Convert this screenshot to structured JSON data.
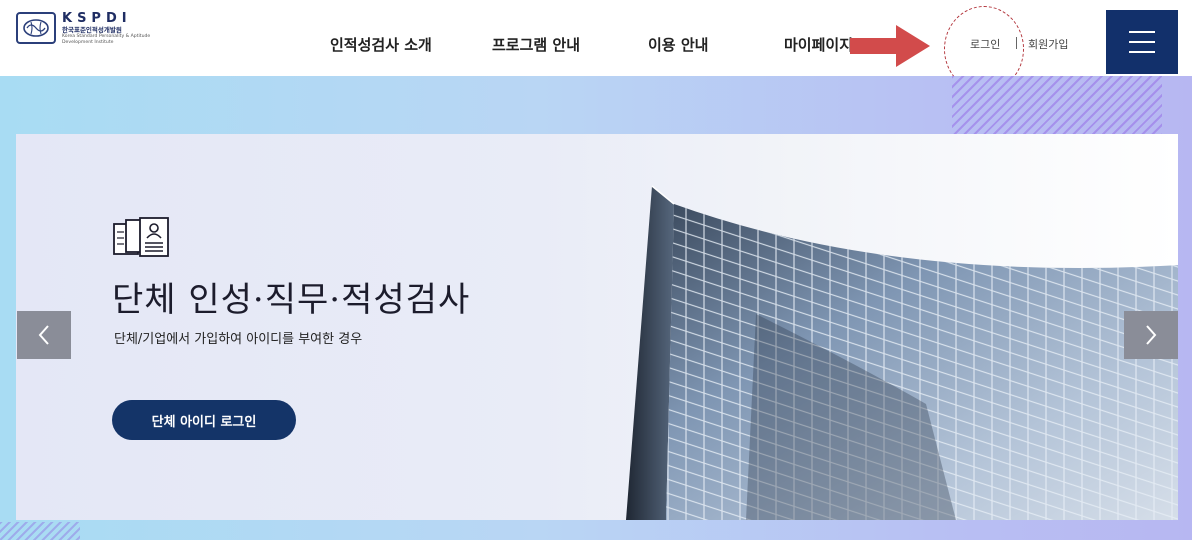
{
  "header": {
    "logo": {
      "abbr": "KSPDI",
      "name_ko": "한국표준인적성개발원",
      "name_en": "Korea Standard Personality & Aptitude Development Institute"
    },
    "nav": [
      {
        "label": "인적성검사 소개"
      },
      {
        "label": "프로그램 안내"
      },
      {
        "label": "이용 안내"
      },
      {
        "label": "마이페이지"
      }
    ],
    "util": {
      "login": "로그인",
      "join": "회원가입"
    },
    "annotation_color": "#d24b4b",
    "menu_icon": "hamburger-icon"
  },
  "hero": {
    "title": "단체 인성·직무·적성검사",
    "subtitle": "단체/기업에서 가입하여 아이디를 부여한 경우",
    "button_label": "단체 아이디 로그인",
    "icon": "document-group-icon",
    "prev_icon": "chevron-left-icon",
    "next_icon": "chevron-right-icon",
    "accent": "#143468"
  }
}
